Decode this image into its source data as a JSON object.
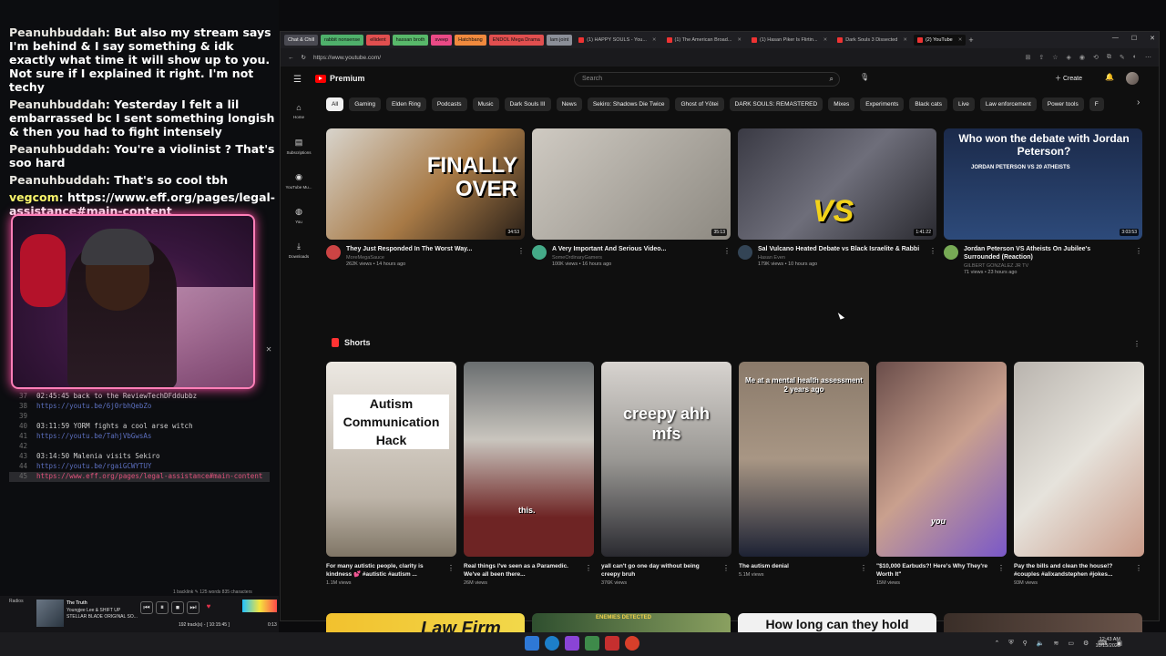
{
  "chat": [
    {
      "user": "Peanuhbuddah",
      "text": "But also my stream says I'm behind & I say something & idk exactly what time it will show up to you. Not sure if I explained it right. I'm not techy"
    },
    {
      "user": "Peanuhbuddah",
      "text": "Yesterday I felt a lil embarrassed bc I sent something longish & then you had to fight intensely"
    },
    {
      "user": "Peanuhbuddah",
      "text": "You're a violinist ? That's soo hard"
    },
    {
      "user": "Peanuhbuddah",
      "text": "That's so cool tbh"
    },
    {
      "user": "vegcom",
      "text": "https://www.eff.org/pages/legal-assistance#main-content"
    }
  ],
  "editor": {
    "lines": [
      {
        "n": "37",
        "text": "02:45:45  back to the ReviewTechDFddubbz"
      },
      {
        "n": "38",
        "text": "https://youtu.be/6j0rbhQebZo",
        "link": true
      },
      {
        "n": "39",
        "text": ""
      },
      {
        "n": "40",
        "text": "03:11:59 YORM fights a cool arse witch"
      },
      {
        "n": "41",
        "text": "https://youtu.be/TahjVbGwsAs",
        "link": true
      },
      {
        "n": "42",
        "text": ""
      },
      {
        "n": "43",
        "text": "03:14:50 Malenia visits Sekiro"
      },
      {
        "n": "44",
        "text": "https://youtu.be/rgaiGCWYTUY",
        "link": true
      },
      {
        "n": "45",
        "text": "https://www.eff.org/pages/legal-assistance#main-content",
        "highlight": true
      }
    ],
    "status": "1 backlink   ✎   125 words  835 characters"
  },
  "media": {
    "radio": "Radios",
    "title": "The Truth",
    "artist": "Youngjee Lee & SHIFT UP",
    "album": "STELLAR BLADE ORIGINAL SO...",
    "tracks": "192 track(s) - [ 10:15:45 ]",
    "time": "0:13",
    "time_end": "4:12"
  },
  "browser": {
    "tabs": [
      {
        "label": "Chat & Chill",
        "cls": "chat"
      },
      {
        "label": "rabbit nonsense",
        "cls": "g1"
      },
      {
        "label": "ellident",
        "cls": "g2"
      },
      {
        "label": "hassan broth",
        "cls": "g3"
      },
      {
        "label": "sveep",
        "cls": "g4"
      },
      {
        "label": "Hatchbang",
        "cls": "g5"
      },
      {
        "label": "ENDOL Mega Drama",
        "cls": "g2"
      },
      {
        "label": "lam joint",
        "cls": "g7"
      },
      {
        "label": "(1) HAPPY SOULS - You...",
        "cls": "plain"
      },
      {
        "label": "(1) The American Broad...",
        "cls": "plain"
      },
      {
        "label": "(1) Hasan Piker Is Flirtin...",
        "cls": "plain"
      },
      {
        "label": "Dark Souls 3 Dissected",
        "cls": "plain"
      },
      {
        "label": "(2) YouTube",
        "cls": "active"
      }
    ],
    "url": "https://www.youtube.com/"
  },
  "youtube": {
    "logo": "Premium",
    "search_placeholder": "Search",
    "create": "Create",
    "sidebar": [
      "Home",
      "Subscriptions",
      "YouTube Mu...",
      "You",
      "Downloads"
    ],
    "chips": [
      "All",
      "Gaming",
      "Elden Ring",
      "Podcasts",
      "Music",
      "Dark Souls III",
      "News",
      "Sekiro: Shadows Die Twice",
      "Ghost of Yōtei",
      "DARK SOULS: REMASTERED",
      "Mixes",
      "Experiments",
      "Black cats",
      "Live",
      "Law enforcement",
      "Power tools",
      "F"
    ],
    "videos": [
      {
        "title": "They Just Responded In The Worst Way...",
        "channel": "MoreMegaSauce",
        "stats": "262K views • 14 hours ago",
        "duration": "34:53",
        "thumb_text": "FINALLY OVER"
      },
      {
        "title": "A Very Important And Serious Video...",
        "channel": "SomeOrdinaryGamers",
        "stats": "100K views • 16 hours ago",
        "duration": "35:13",
        "thumb_text": ""
      },
      {
        "title": "Sal Vulcano Heated Debate vs Black Israelite & Rabbi",
        "channel": "Hasan Even",
        "stats": "179K views • 10 hours ago",
        "duration": "1:41:22",
        "thumb_text": "VS"
      },
      {
        "title": "Jordan Peterson VS Atheists On Jubilee's Surrounded (Reaction)",
        "channel": "GILBERT GONZALEZ JR TV",
        "stats": "71 views • 23 hours ago",
        "duration": "3:03:53",
        "thumb_text": "Who won the debate with Jordan Peterson?",
        "thumb_sub": "JORDAN PETERSON VS 20 ATHEISTS"
      }
    ],
    "shorts_label": "Shorts",
    "shorts": [
      {
        "title": "For many autistic people, clarity is kindness 💕 #autistic #autism ...",
        "views": "1.1M views",
        "thumb_text": "Autism Communication Hack"
      },
      {
        "title": "Real things I've seen as a Paramedic. We've all been there...",
        "views": "26M views",
        "thumb_text": "this."
      },
      {
        "title": "yall can't go one day without being creepy bruh",
        "views": "376K views",
        "thumb_text": "creepy ahh mfs"
      },
      {
        "title": "The autism denial",
        "views": "5.1M views",
        "thumb_text": "Me at a mental health assessment 2 years ago"
      },
      {
        "title": "\"$10,000 Earbuds?! Here's Why They're Worth It\"",
        "views": "15M views",
        "thumb_text": "you"
      },
      {
        "title": "Pay the bills and clean the house!? #couples #alixandstephen #jokes...",
        "views": "93M views",
        "thumb_text": ""
      }
    ],
    "row3": [
      {
        "thumb_text": "Law Firm"
      },
      {
        "thumb_text": "ENEMIES DETECTED"
      },
      {
        "thumb_text": "How long can they hold liquid?"
      },
      {
        "thumb_text": ""
      }
    ]
  },
  "taskbar": {
    "time": "12:43 AM",
    "date": "10/13/2025"
  }
}
